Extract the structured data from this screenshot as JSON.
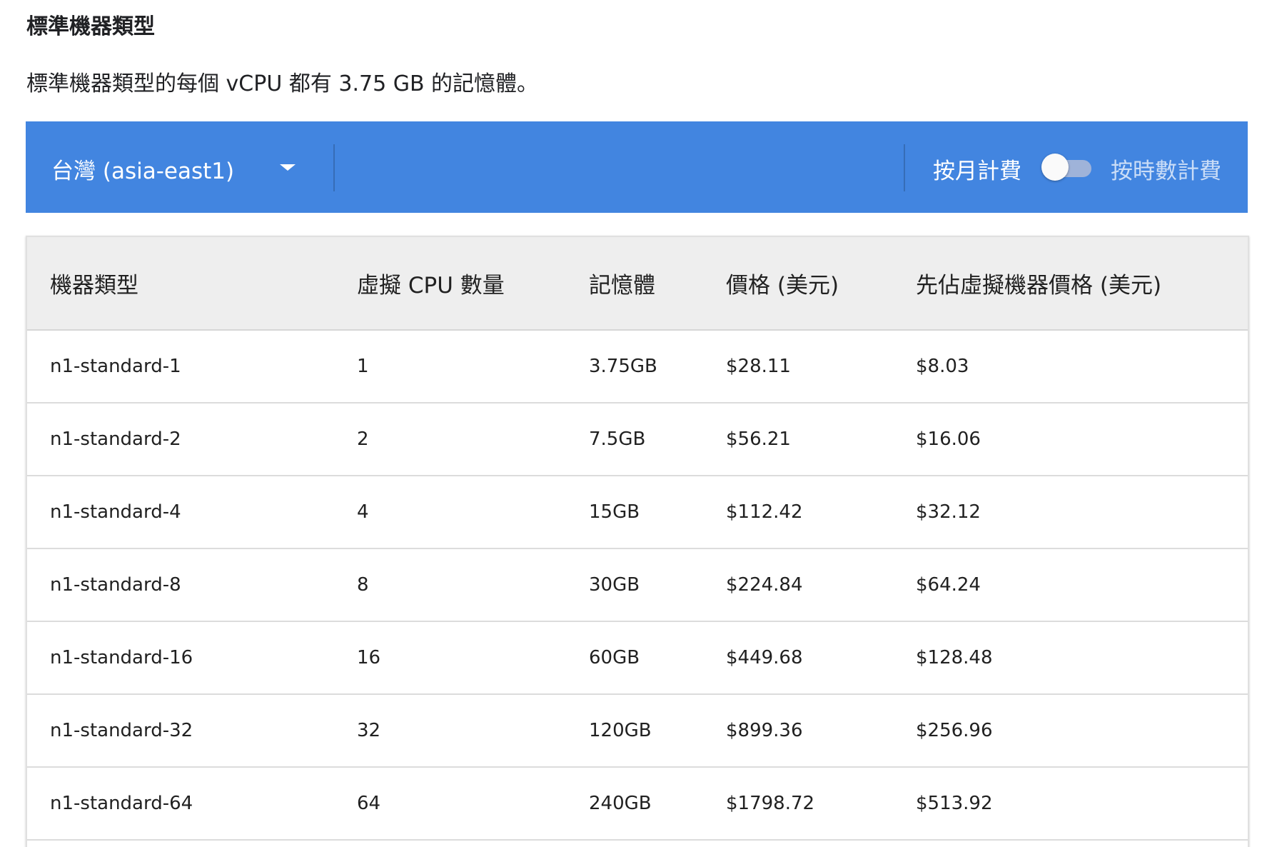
{
  "section": {
    "title": "標準機器類型",
    "description": "標準機器類型的每個 vCPU 都有 3.75 GB 的記憶體。"
  },
  "toolbar": {
    "region": "台灣 (asia-east1)",
    "region_icon": "caret-down-icon",
    "billing_monthly": "按月計費",
    "billing_hourly": "按時數計費",
    "billing_toggle_on": false,
    "color": "#4285e0"
  },
  "table": {
    "headers": [
      "機器類型",
      "虛擬 CPU 數量",
      "記憶體",
      "價格 (美元)",
      "先佔虛擬機器價格 (美元)"
    ],
    "rows": [
      [
        "n1-standard-1",
        "1",
        "3.75GB",
        "$28.11",
        "$8.03"
      ],
      [
        "n1-standard-2",
        "2",
        "7.5GB",
        "$56.21",
        "$16.06"
      ],
      [
        "n1-standard-4",
        "4",
        "15GB",
        "$112.42",
        "$32.12"
      ],
      [
        "n1-standard-8",
        "8",
        "30GB",
        "$224.84",
        "$64.24"
      ],
      [
        "n1-standard-16",
        "16",
        "60GB",
        "$449.68",
        "$128.48"
      ],
      [
        "n1-standard-32",
        "32",
        "120GB",
        "$899.36",
        "$256.96"
      ],
      [
        "n1-standard-64",
        "64",
        "240GB",
        "$1798.72",
        "$513.92"
      ]
    ]
  }
}
